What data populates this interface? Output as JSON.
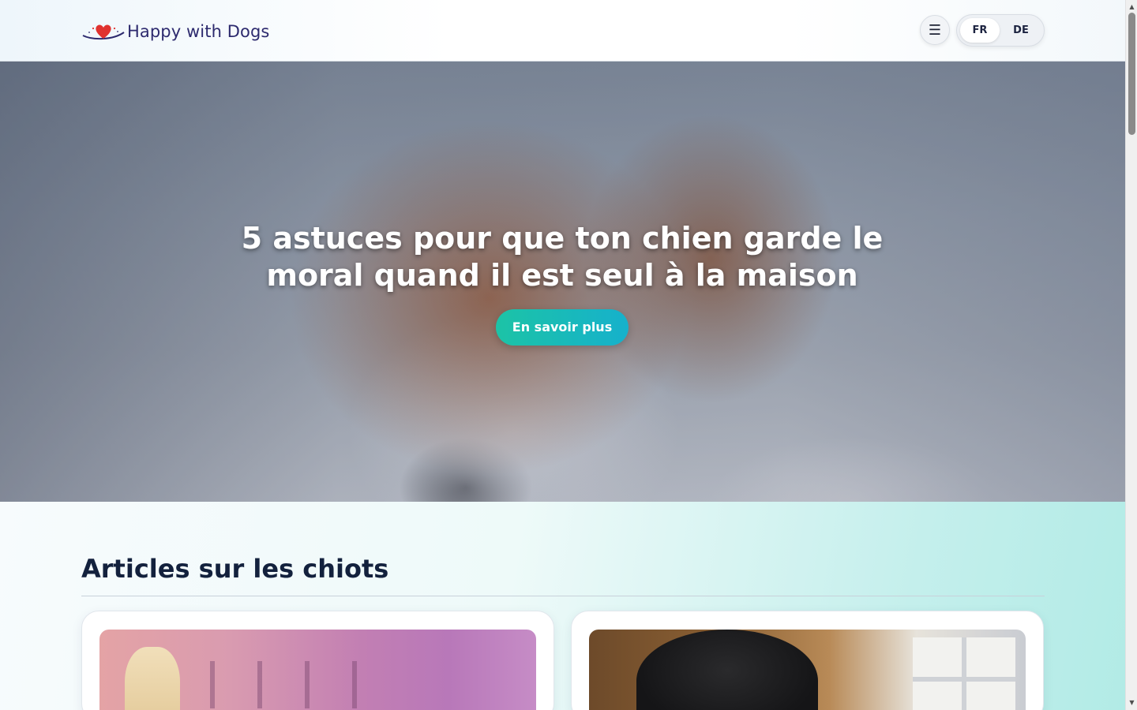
{
  "header": {
    "logo_text": "Happy with Dogs",
    "menu_icon": "☰",
    "languages": [
      {
        "code": "FR",
        "active": true
      },
      {
        "code": "DE",
        "active": false
      }
    ]
  },
  "hero": {
    "title": "5 astuces pour que ton chien garde le moral quand il est seul à la maison",
    "button_label": "En savoir plus"
  },
  "section": {
    "title": "Articles sur les chiots"
  },
  "colors": {
    "brand_navy": "#2d2a6e",
    "accent_teal": "#1cc3a6",
    "heart_red": "#e0322f"
  },
  "icons": [
    "hamburger-menu-icon",
    "heart-logo-icon",
    "scroll-up-arrow",
    "scroll-down-arrow"
  ]
}
